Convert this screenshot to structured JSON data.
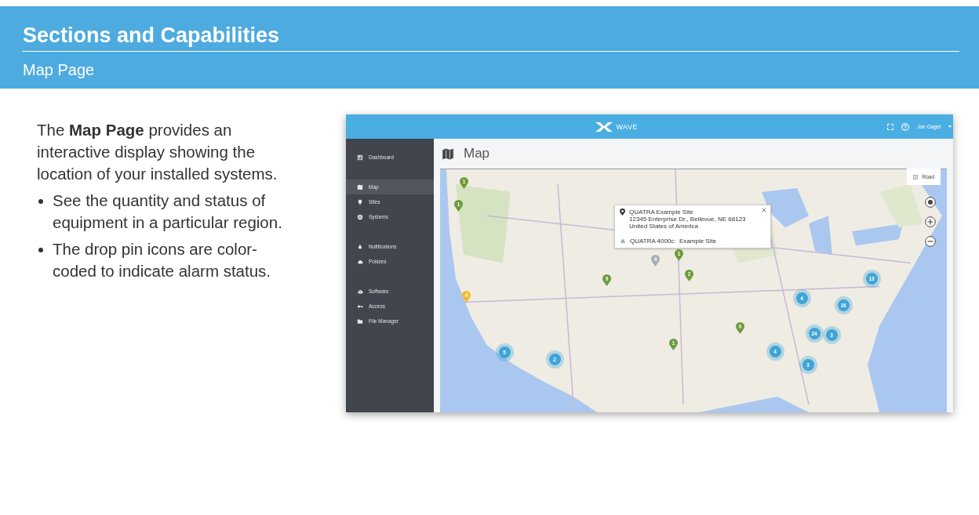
{
  "slide": {
    "title": "Sections and Capabilities",
    "subtitle": "Map Page"
  },
  "description": {
    "intro": "The **Map Page** provides an interactive display showing the location of your installed systems.",
    "bullets": [
      "See the quantity and status of equipment in a particular region.",
      "The drop pin icons are color-coded to indicate alarm status."
    ]
  },
  "app": {
    "brand": "WAVE",
    "user": "Joe Gagel",
    "sidebar_groups": [
      {
        "items": [
          {
            "label": "Dashboard",
            "kind": "dashboard",
            "selected": false
          }
        ]
      },
      {
        "items": [
          {
            "label": "Map",
            "kind": "map",
            "selected": true
          },
          {
            "label": "Sites",
            "kind": "pin",
            "selected": false
          },
          {
            "label": "Systems",
            "kind": "systems",
            "selected": false
          }
        ]
      },
      {
        "items": [
          {
            "label": "Notifications",
            "kind": "bell",
            "selected": false
          },
          {
            "label": "Policies",
            "kind": "cloud",
            "selected": false
          }
        ]
      },
      {
        "items": [
          {
            "label": "Software",
            "kind": "upload",
            "selected": false
          },
          {
            "label": "Access",
            "kind": "key",
            "selected": false
          },
          {
            "label": "File Manager",
            "kind": "folder",
            "selected": false
          }
        ]
      }
    ],
    "page_title": "Map",
    "map": {
      "layer_button": "Road",
      "popup": {
        "site_name": "QUATRA Example Site",
        "address": [
          "12345 Enterprise Dr., Bellevue, NE 68123",
          "United States of America"
        ],
        "system": "QUATRA 4000c:  Example Site"
      },
      "markers": [
        {
          "kind": "pin",
          "count": "1",
          "color": "#6e9b3a"
        },
        {
          "kind": "pin",
          "count": "1",
          "color": "#6e9b3a"
        },
        {
          "kind": "pin",
          "count": "4",
          "color": "#f2b92a"
        },
        {
          "kind": "pin",
          "count": "4",
          "color": "#a9aeb4"
        },
        {
          "kind": "pin",
          "count": "1",
          "color": "#6e9b3a"
        },
        {
          "kind": "pin",
          "count": "2",
          "color": "#6e9b3a"
        },
        {
          "kind": "pin",
          "count": "9",
          "color": "#6e9b3a"
        },
        {
          "kind": "pin",
          "count": "0",
          "color": "#6e9b3a"
        },
        {
          "kind": "pin",
          "count": "1",
          "color": "#6e9b3a"
        },
        {
          "kind": "cluster",
          "count": "5",
          "color": "#3fa4d8"
        },
        {
          "kind": "cluster",
          "count": "2",
          "color": "#3fa4d8"
        },
        {
          "kind": "cluster",
          "count": "4",
          "color": "#3fa4d8"
        },
        {
          "kind": "cluster",
          "count": "16",
          "color": "#3fa4d8"
        },
        {
          "kind": "cluster",
          "count": "13",
          "color": "#3fa4d8"
        },
        {
          "kind": "cluster",
          "count": "24",
          "color": "#3fa4d8"
        },
        {
          "kind": "cluster",
          "count": "3",
          "color": "#3fa4d8"
        },
        {
          "kind": "cluster",
          "count": "4",
          "color": "#3fa4d8"
        },
        {
          "kind": "cluster",
          "count": "3",
          "color": "#3fa4d8"
        }
      ]
    }
  }
}
